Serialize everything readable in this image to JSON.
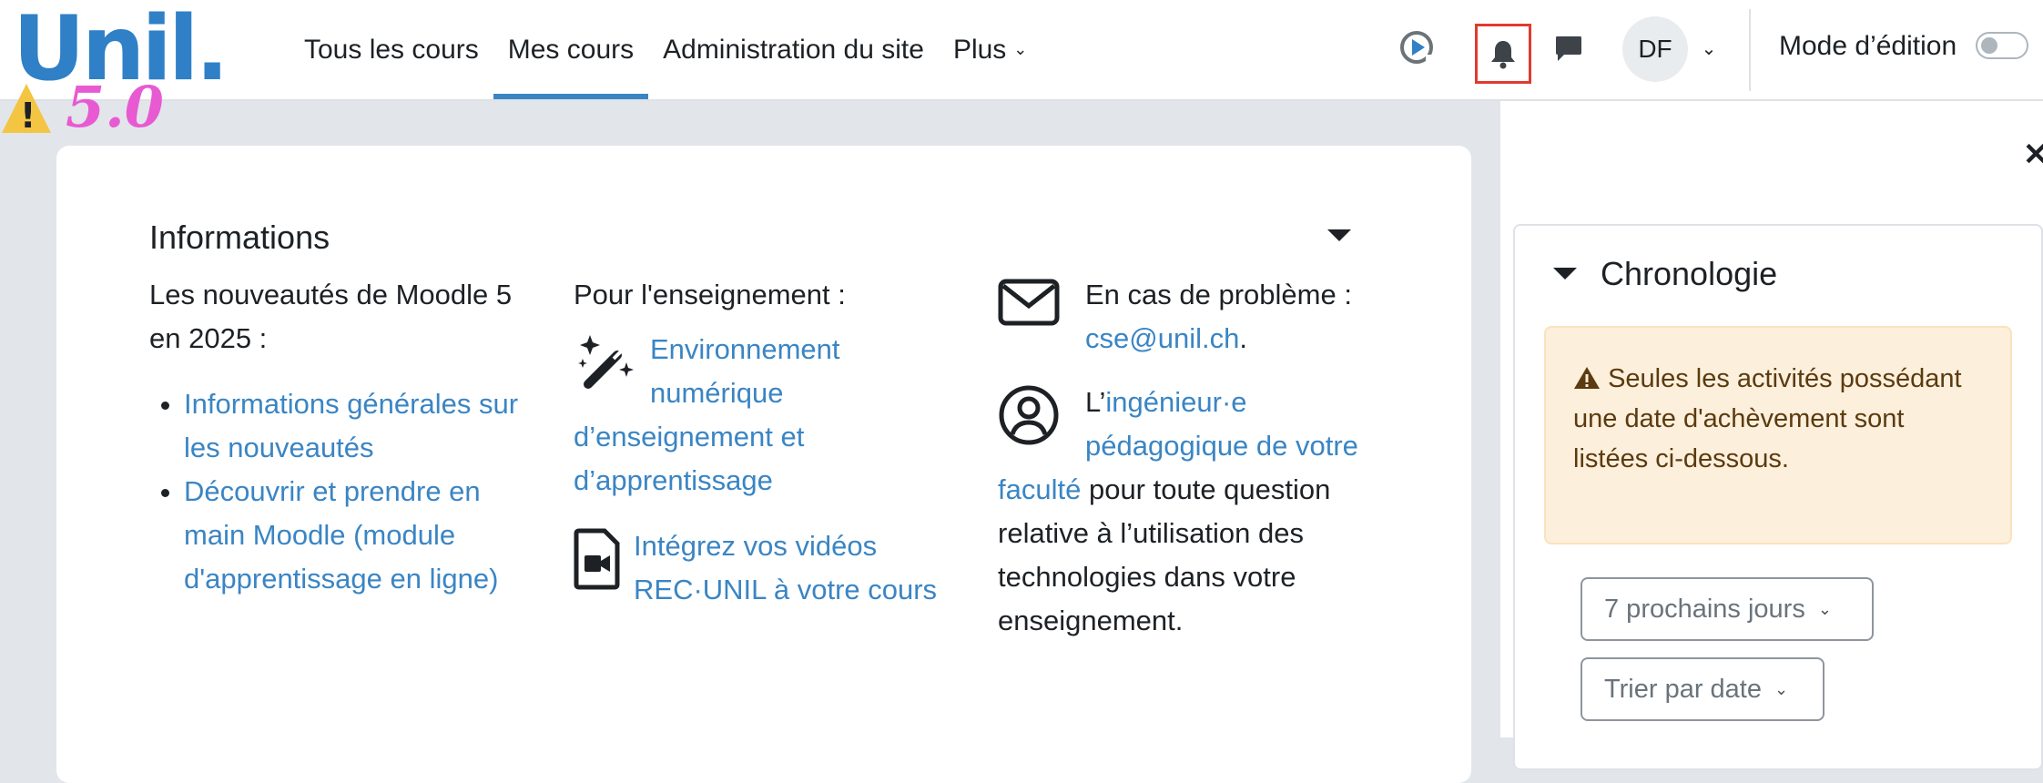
{
  "brand": {
    "logo_text": "Unil.",
    "version": "5.0"
  },
  "nav": {
    "links": [
      {
        "label": "Tous les cours"
      },
      {
        "label": "Mes cours"
      },
      {
        "label": "Administration du site"
      },
      {
        "label": "Plus"
      }
    ],
    "active_index": 1
  },
  "user": {
    "initials": "DF"
  },
  "edit_mode": {
    "label": "Mode d’édition",
    "enabled": false
  },
  "info": {
    "title": "Informations",
    "col1": {
      "intro": "Les nouveautés de Moodle 5 en 2025 :",
      "links": [
        "Informations générales sur les nouveautés",
        "Découvrir et prendre en main Moodle (module d'apprentissage en ligne)"
      ]
    },
    "col2": {
      "intro": "Pour l'enseignement :",
      "link1": "Environnement numérique d’enseignement et d’apprentissage",
      "link2": "Intégrez vos vidéos REC·UNIL à votre cours"
    },
    "col3": {
      "problem_text": "En cas de problème :",
      "email": "cse@unil.ch",
      "email_suffix": ".",
      "engineer_prefix": "L’",
      "engineer_link": "ingénieur·e pédagogique de votre faculté",
      "engineer_text": " pour toute question relative à l’utilisation des technologies dans votre enseignement."
    }
  },
  "sidebar": {
    "title": "Chronologie",
    "alert": "Seules les activités possédant une date d'achèvement sont listées ci-dessous.",
    "filter": "7 prochains jours",
    "sort": "Trier par date"
  },
  "colors": {
    "accent": "#3a85c4",
    "brand": "#2f80c6",
    "highlight": "#e03a2f"
  }
}
